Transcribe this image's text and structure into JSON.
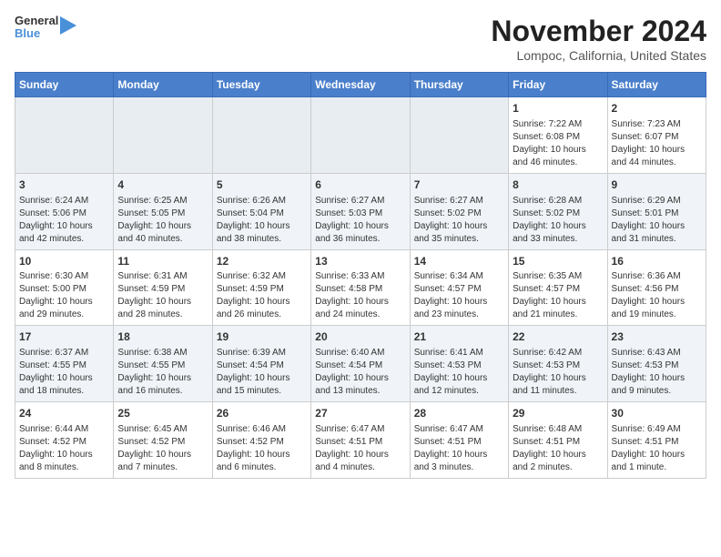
{
  "header": {
    "logo_line1": "General",
    "logo_line2": "Blue",
    "month_title": "November 2024",
    "location": "Lompoc, California, United States"
  },
  "days_of_week": [
    "Sunday",
    "Monday",
    "Tuesday",
    "Wednesday",
    "Thursday",
    "Friday",
    "Saturday"
  ],
  "weeks": [
    [
      {
        "day": "",
        "content": ""
      },
      {
        "day": "",
        "content": ""
      },
      {
        "day": "",
        "content": ""
      },
      {
        "day": "",
        "content": ""
      },
      {
        "day": "",
        "content": ""
      },
      {
        "day": "1",
        "content": "Sunrise: 7:22 AM\nSunset: 6:08 PM\nDaylight: 10 hours and 46 minutes."
      },
      {
        "day": "2",
        "content": "Sunrise: 7:23 AM\nSunset: 6:07 PM\nDaylight: 10 hours and 44 minutes."
      }
    ],
    [
      {
        "day": "3",
        "content": "Sunrise: 6:24 AM\nSunset: 5:06 PM\nDaylight: 10 hours and 42 minutes."
      },
      {
        "day": "4",
        "content": "Sunrise: 6:25 AM\nSunset: 5:05 PM\nDaylight: 10 hours and 40 minutes."
      },
      {
        "day": "5",
        "content": "Sunrise: 6:26 AM\nSunset: 5:04 PM\nDaylight: 10 hours and 38 minutes."
      },
      {
        "day": "6",
        "content": "Sunrise: 6:27 AM\nSunset: 5:03 PM\nDaylight: 10 hours and 36 minutes."
      },
      {
        "day": "7",
        "content": "Sunrise: 6:27 AM\nSunset: 5:02 PM\nDaylight: 10 hours and 35 minutes."
      },
      {
        "day": "8",
        "content": "Sunrise: 6:28 AM\nSunset: 5:02 PM\nDaylight: 10 hours and 33 minutes."
      },
      {
        "day": "9",
        "content": "Sunrise: 6:29 AM\nSunset: 5:01 PM\nDaylight: 10 hours and 31 minutes."
      }
    ],
    [
      {
        "day": "10",
        "content": "Sunrise: 6:30 AM\nSunset: 5:00 PM\nDaylight: 10 hours and 29 minutes."
      },
      {
        "day": "11",
        "content": "Sunrise: 6:31 AM\nSunset: 4:59 PM\nDaylight: 10 hours and 28 minutes."
      },
      {
        "day": "12",
        "content": "Sunrise: 6:32 AM\nSunset: 4:59 PM\nDaylight: 10 hours and 26 minutes."
      },
      {
        "day": "13",
        "content": "Sunrise: 6:33 AM\nSunset: 4:58 PM\nDaylight: 10 hours and 24 minutes."
      },
      {
        "day": "14",
        "content": "Sunrise: 6:34 AM\nSunset: 4:57 PM\nDaylight: 10 hours and 23 minutes."
      },
      {
        "day": "15",
        "content": "Sunrise: 6:35 AM\nSunset: 4:57 PM\nDaylight: 10 hours and 21 minutes."
      },
      {
        "day": "16",
        "content": "Sunrise: 6:36 AM\nSunset: 4:56 PM\nDaylight: 10 hours and 19 minutes."
      }
    ],
    [
      {
        "day": "17",
        "content": "Sunrise: 6:37 AM\nSunset: 4:55 PM\nDaylight: 10 hours and 18 minutes."
      },
      {
        "day": "18",
        "content": "Sunrise: 6:38 AM\nSunset: 4:55 PM\nDaylight: 10 hours and 16 minutes."
      },
      {
        "day": "19",
        "content": "Sunrise: 6:39 AM\nSunset: 4:54 PM\nDaylight: 10 hours and 15 minutes."
      },
      {
        "day": "20",
        "content": "Sunrise: 6:40 AM\nSunset: 4:54 PM\nDaylight: 10 hours and 13 minutes."
      },
      {
        "day": "21",
        "content": "Sunrise: 6:41 AM\nSunset: 4:53 PM\nDaylight: 10 hours and 12 minutes."
      },
      {
        "day": "22",
        "content": "Sunrise: 6:42 AM\nSunset: 4:53 PM\nDaylight: 10 hours and 11 minutes."
      },
      {
        "day": "23",
        "content": "Sunrise: 6:43 AM\nSunset: 4:53 PM\nDaylight: 10 hours and 9 minutes."
      }
    ],
    [
      {
        "day": "24",
        "content": "Sunrise: 6:44 AM\nSunset: 4:52 PM\nDaylight: 10 hours and 8 minutes."
      },
      {
        "day": "25",
        "content": "Sunrise: 6:45 AM\nSunset: 4:52 PM\nDaylight: 10 hours and 7 minutes."
      },
      {
        "day": "26",
        "content": "Sunrise: 6:46 AM\nSunset: 4:52 PM\nDaylight: 10 hours and 6 minutes."
      },
      {
        "day": "27",
        "content": "Sunrise: 6:47 AM\nSunset: 4:51 PM\nDaylight: 10 hours and 4 minutes."
      },
      {
        "day": "28",
        "content": "Sunrise: 6:47 AM\nSunset: 4:51 PM\nDaylight: 10 hours and 3 minutes."
      },
      {
        "day": "29",
        "content": "Sunrise: 6:48 AM\nSunset: 4:51 PM\nDaylight: 10 hours and 2 minutes."
      },
      {
        "day": "30",
        "content": "Sunrise: 6:49 AM\nSunset: 4:51 PM\nDaylight: 10 hours and 1 minute."
      }
    ]
  ]
}
